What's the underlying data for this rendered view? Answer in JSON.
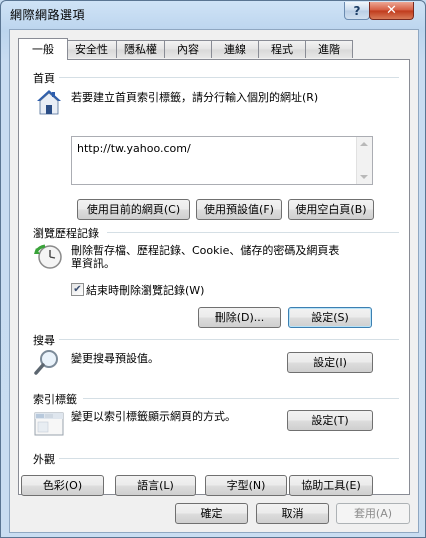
{
  "window": {
    "title": "網際網路選項",
    "help_glyph": "?",
    "close_glyph": "✕"
  },
  "tabs": [
    {
      "label": "一般",
      "active": true
    },
    {
      "label": "安全性"
    },
    {
      "label": "隱私權"
    },
    {
      "label": "內容"
    },
    {
      "label": "連線"
    },
    {
      "label": "程式"
    },
    {
      "label": "進階"
    }
  ],
  "home": {
    "label": "首頁",
    "description": "若要建立首頁索引標籤，請分行輸入個別的網址(R)",
    "url": "http://tw.yahoo.com/",
    "use_current": "使用目前的網頁(C)",
    "use_default": "使用預設值(F)",
    "use_blank": "使用空白頁(B)",
    "icon": "home-icon"
  },
  "history": {
    "label": "瀏覽歷程記錄",
    "description_line1": "刪除暫存檔、歷程記錄、Cookie、儲存的密碼及網頁表",
    "description_line2": "單資訊。",
    "checkbox_label": "結束時刪除瀏覽記錄(W)",
    "checkbox_checked": true,
    "delete": "刪除(D)...",
    "settings": "設定(S)",
    "icon": "history-clock-icon"
  },
  "search": {
    "label": "搜尋",
    "description": "變更搜尋預設值。",
    "settings": "設定(I)",
    "icon": "magnifier-icon"
  },
  "tabs_group": {
    "label": "索引標籤",
    "description": "變更以索引標籤顯示網頁的方式。",
    "settings": "設定(T)",
    "icon": "tabbed-window-icon"
  },
  "appearance": {
    "label": "外觀",
    "colors": "色彩(O)",
    "languages": "語言(L)",
    "fonts": "字型(N)",
    "accessibility": "協助工具(E)"
  },
  "footer": {
    "ok": "確定",
    "cancel": "取消",
    "apply": "套用(A)"
  }
}
